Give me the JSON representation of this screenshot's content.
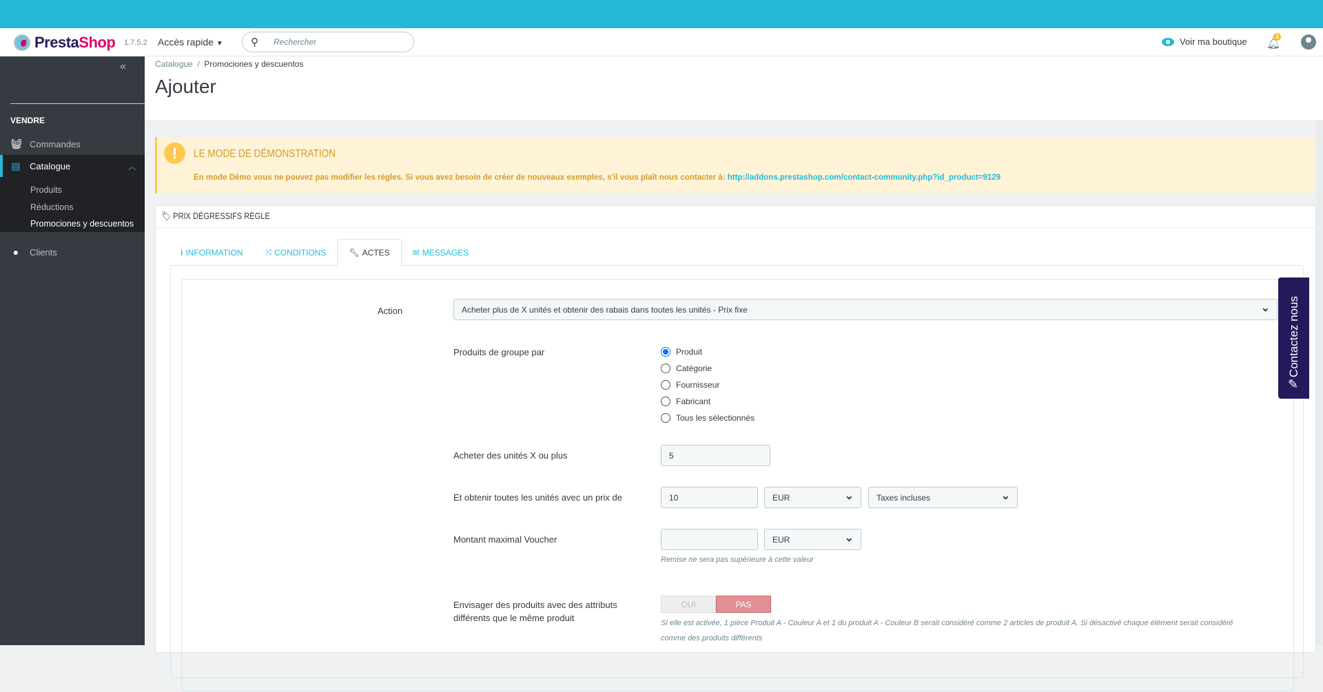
{
  "header": {
    "logo_prefix": "Presta",
    "logo_suffix": "Shop",
    "version": "1.7.5.2",
    "quick_access": "Accès rapide",
    "search_placeholder": "Rechercher",
    "view_shop": "Voir ma boutique",
    "notifications": "3"
  },
  "sidebar": {
    "section": "VENDRE",
    "items": [
      {
        "label": "Commandes"
      },
      {
        "label": "Catalogue"
      },
      {
        "label": "Clients"
      }
    ],
    "sub": [
      "Produits",
      "Réductions",
      "Promociones y descuentos"
    ]
  },
  "breadcrumb": {
    "parent": "Catalogue",
    "sep": "/",
    "current": "Promociones y descuentos"
  },
  "page_title": "Ajouter",
  "alert": {
    "title": "LE MODE DE DÉMONSTRATION",
    "message": "En mode Démo vous ne pouvez pas modifier les règles. Si vous avez besoin de créer de nouveaux exemples, s'il vous plaît nous contacter à:",
    "link": "http://addons.prestashop.com/contact-community.php?id_product=9129"
  },
  "panel": {
    "title": "PRIX DÉGRESSIFS RÈGLE",
    "tabs": [
      "INFORMATION",
      "CONDITIONS",
      "ACTES",
      "MESSAGES"
    ]
  },
  "form": {
    "action_label": "Action",
    "action_value": "Acheter plus de X unités et obtenir des rabais dans toutes les unités - Prix fixe",
    "group_label": "Produits de groupe par",
    "group_options": [
      "Produit",
      "Catégorie",
      "Fournisseur",
      "Fabricant",
      "Tous les sélectionnés"
    ],
    "group_selected": "Produit",
    "units_label": "Acheter des unités X ou plus",
    "units_value": "5",
    "price_label": "Et obtenir toutes les unités avec un prix de",
    "price_value": "10",
    "price_currency": "EUR",
    "price_tax": "Taxes incluses",
    "voucher_label": "Montant maximal Voucher",
    "voucher_value": "",
    "voucher_currency": "EUR",
    "voucher_help": "Remise ne sera pas supérieure à cette valeur",
    "attr_label_1": "Envisager des produits avec des attributs",
    "attr_label_2": "différents que le même produit",
    "toggle_on": "OUI",
    "toggle_off": "PAS",
    "toggle_value": "PAS",
    "attr_help_1": "Si elle est activée, 1 pièce Produit A - Couleur A et 1 du produit A - Couleur B serait considéré comme 2 articles de produit A. Si désactivé chaque élément serait considéré",
    "attr_help_2": "comme des produits différents"
  },
  "contact_tab": "Contactez nous"
}
